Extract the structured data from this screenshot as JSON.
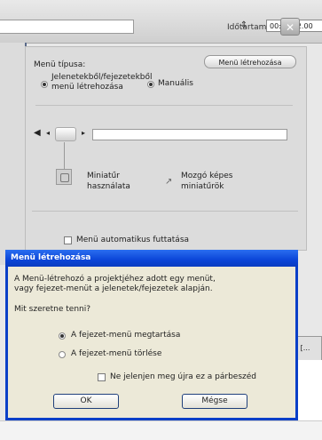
{
  "toolbar": {
    "duration_label": "Időtartam:",
    "duration_value": "00:00:12.00"
  },
  "menu_panel": {
    "menu_button_label": "Menü létrehozása",
    "menu_type_label": "Menü típusa:",
    "option_chapters_line1": "Jelenetekből/fejezetekből",
    "option_chapters_line2": "menü létrehozása",
    "option_manual": "Manuális",
    "thumbnail_option_line1": "Miniatűr",
    "thumbnail_option_line2": "használata",
    "motion_option_line1": "Mozgó képes",
    "motion_option_line2": "miniatűrök",
    "autoplay_checkbox": "Menü automatikus futtatása"
  },
  "dialog": {
    "title": "Menü létrehozása",
    "message_line1": "A Menü-létrehozó a projektjéhez adott egy menüt,",
    "message_line2": "vagy fejezet-menüt a jelenetek/fejezetek alapján.",
    "question": "Mit szeretne tenni?",
    "option_1": "A fejezet-menü megtartása",
    "option_2": "A fejezet-menü törlése",
    "checkbox": "Ne jelenjen meg újra ez a párbeszéd",
    "ok_label": "OK",
    "cancel_label": "Mégse"
  },
  "colors": {
    "title_bar": "#0b45d8",
    "dialog_bg": "#ece9d8",
    "panel_bg": "#dcdcdc"
  }
}
